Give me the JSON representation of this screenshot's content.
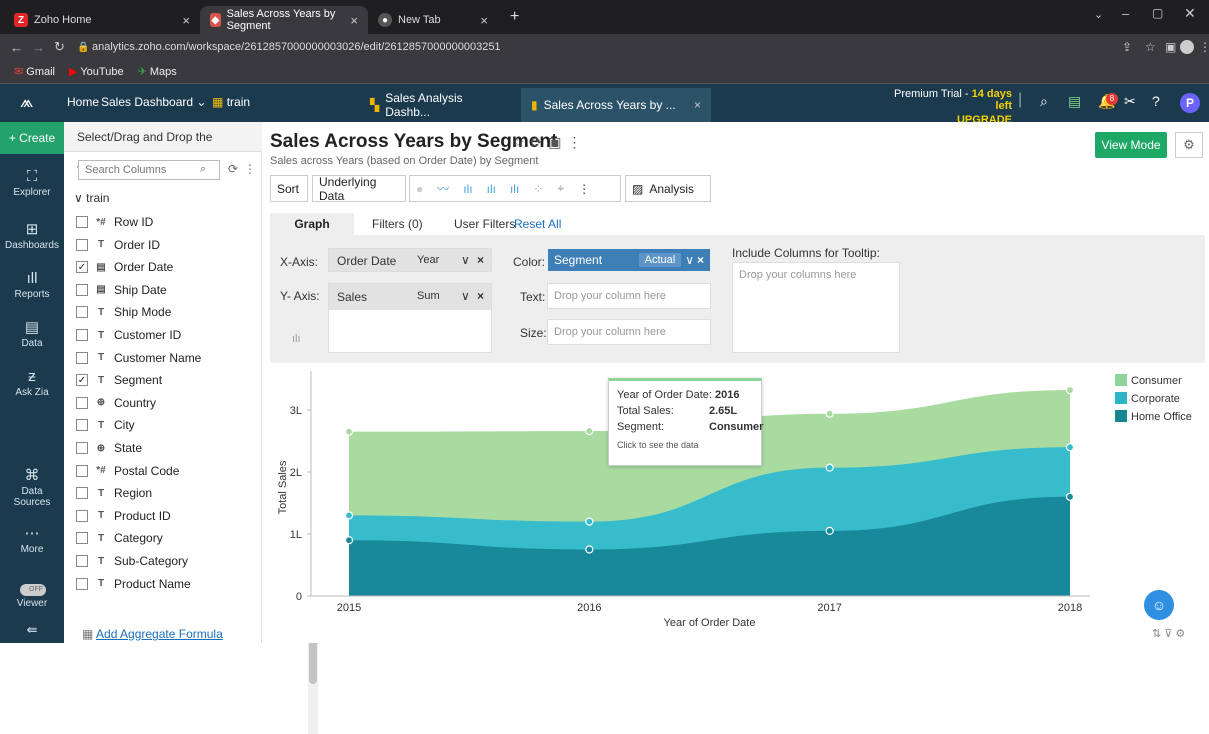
{
  "browser": {
    "tabs": [
      {
        "label": "Zoho Home",
        "icon": "zoho-icon"
      },
      {
        "label": "Sales Across Years by Segment",
        "icon": "analytics-icon"
      },
      {
        "label": "New Tab",
        "icon": "chrome-icon"
      }
    ],
    "url": "analytics.zoho.com/workspace/2612857000000003026/edit/2612857000000003251",
    "bookmarks": [
      "Gmail",
      "YouTube",
      "Maps"
    ]
  },
  "app": {
    "home": "Home",
    "dashboard_menu": "Sales Dashboard",
    "workspace": "train",
    "open_tabs": [
      "Sales Analysis Dashb...",
      "Sales Across Years by ..."
    ],
    "trial_text": "Premium Trial - ",
    "trial_days": "14 days left",
    "upgrade": "UPGRADE",
    "notification_count": "8",
    "profile_initial": "P"
  },
  "rail": {
    "create": "+ Create",
    "items": [
      "Explorer",
      "Dashboards",
      "Reports",
      "Data",
      "Ask Zia",
      "Data Sources",
      "More"
    ],
    "viewer_toggle": "OFF",
    "viewer": "Viewer"
  },
  "columns": {
    "header": "Select/Drag and Drop the Columns",
    "search_placeholder": "Search Columns",
    "table": "train",
    "items": [
      {
        "name": "Row ID",
        "type": "*#",
        "checked": false
      },
      {
        "name": "Order ID",
        "type": "T",
        "checked": false
      },
      {
        "name": "Order Date",
        "type": "cal",
        "checked": true
      },
      {
        "name": "Ship Date",
        "type": "cal",
        "checked": false
      },
      {
        "name": "Ship Mode",
        "type": "T",
        "checked": false
      },
      {
        "name": "Customer ID",
        "type": "T",
        "checked": false
      },
      {
        "name": "Customer Name",
        "type": "T",
        "checked": false
      },
      {
        "name": "Segment",
        "type": "T",
        "checked": true
      },
      {
        "name": "Country",
        "type": "geo",
        "checked": false
      },
      {
        "name": "City",
        "type": "T",
        "checked": false
      },
      {
        "name": "State",
        "type": "geo",
        "checked": false
      },
      {
        "name": "Postal Code",
        "type": "*#",
        "checked": false
      },
      {
        "name": "Region",
        "type": "T",
        "checked": false
      },
      {
        "name": "Product ID",
        "type": "T",
        "checked": false
      },
      {
        "name": "Category",
        "type": "T",
        "checked": false
      },
      {
        "name": "Sub-Category",
        "type": "T",
        "checked": false
      },
      {
        "name": "Product Name",
        "type": "T",
        "checked": false
      }
    ],
    "add_formula": "Add Aggregate Formula"
  },
  "report": {
    "title": "Sales Across Years by Segment",
    "subtitle": "Sales across Years (based on Order Date) by Segment",
    "view_mode": "View Mode",
    "toolbar": {
      "sort": "Sort",
      "underlying": "Underlying Data",
      "analysis": "Analysis"
    },
    "tabs": {
      "graph": "Graph",
      "filters": "Filters (0)",
      "user_filters": "User Filters",
      "reset": "Reset All"
    },
    "xaxis": {
      "label": "X-Axis:",
      "column": "Order Date",
      "fn": "Year"
    },
    "yaxis": {
      "label": "Y- Axis:",
      "column": "Sales",
      "fn": "Sum"
    },
    "color": {
      "label": "Color:",
      "column": "Segment",
      "fn": "Actual"
    },
    "text": {
      "label": "Text:",
      "placeholder": "Drop your column here"
    },
    "size": {
      "label": "Size:",
      "placeholder": "Drop your column here"
    },
    "tooltip_cols": {
      "label": "Include Columns for Tooltip:",
      "placeholder": "Drop your columns here"
    }
  },
  "tooltip": {
    "year_label": "Year of Order Date:",
    "year": "2016",
    "sales_label": "Total Sales:",
    "sales": "2.65L",
    "seg_label": "Segment:",
    "seg": "Consumer",
    "hint": "Click to see the data"
  },
  "chart_data": {
    "type": "area",
    "stacked": true,
    "x": [
      "2015",
      "2016",
      "2017",
      "2018"
    ],
    "xlabel": "Year of Order Date",
    "ylabel": "Total Sales",
    "yticks": [
      "0",
      "1L",
      "2L",
      "3L"
    ],
    "ylim": [
      0,
      3.5
    ],
    "series": [
      {
        "name": "Home Office",
        "values": [
          0.9,
          0.75,
          1.05,
          1.6
        ],
        "color": "#17899a"
      },
      {
        "name": "Corporate",
        "values": [
          0.4,
          0.45,
          1.02,
          0.8
        ],
        "color": "#36bccb"
      },
      {
        "name": "Consumer",
        "values": [
          1.35,
          1.46,
          0.87,
          0.92
        ],
        "color": "#a9dba1"
      }
    ],
    "legend": [
      "Consumer",
      "Corporate",
      "Home Office"
    ],
    "legend_colors": [
      "#8fd49a",
      "#2bb5c6",
      "#15858f"
    ],
    "legend_position": "top-right",
    "grid": false
  }
}
